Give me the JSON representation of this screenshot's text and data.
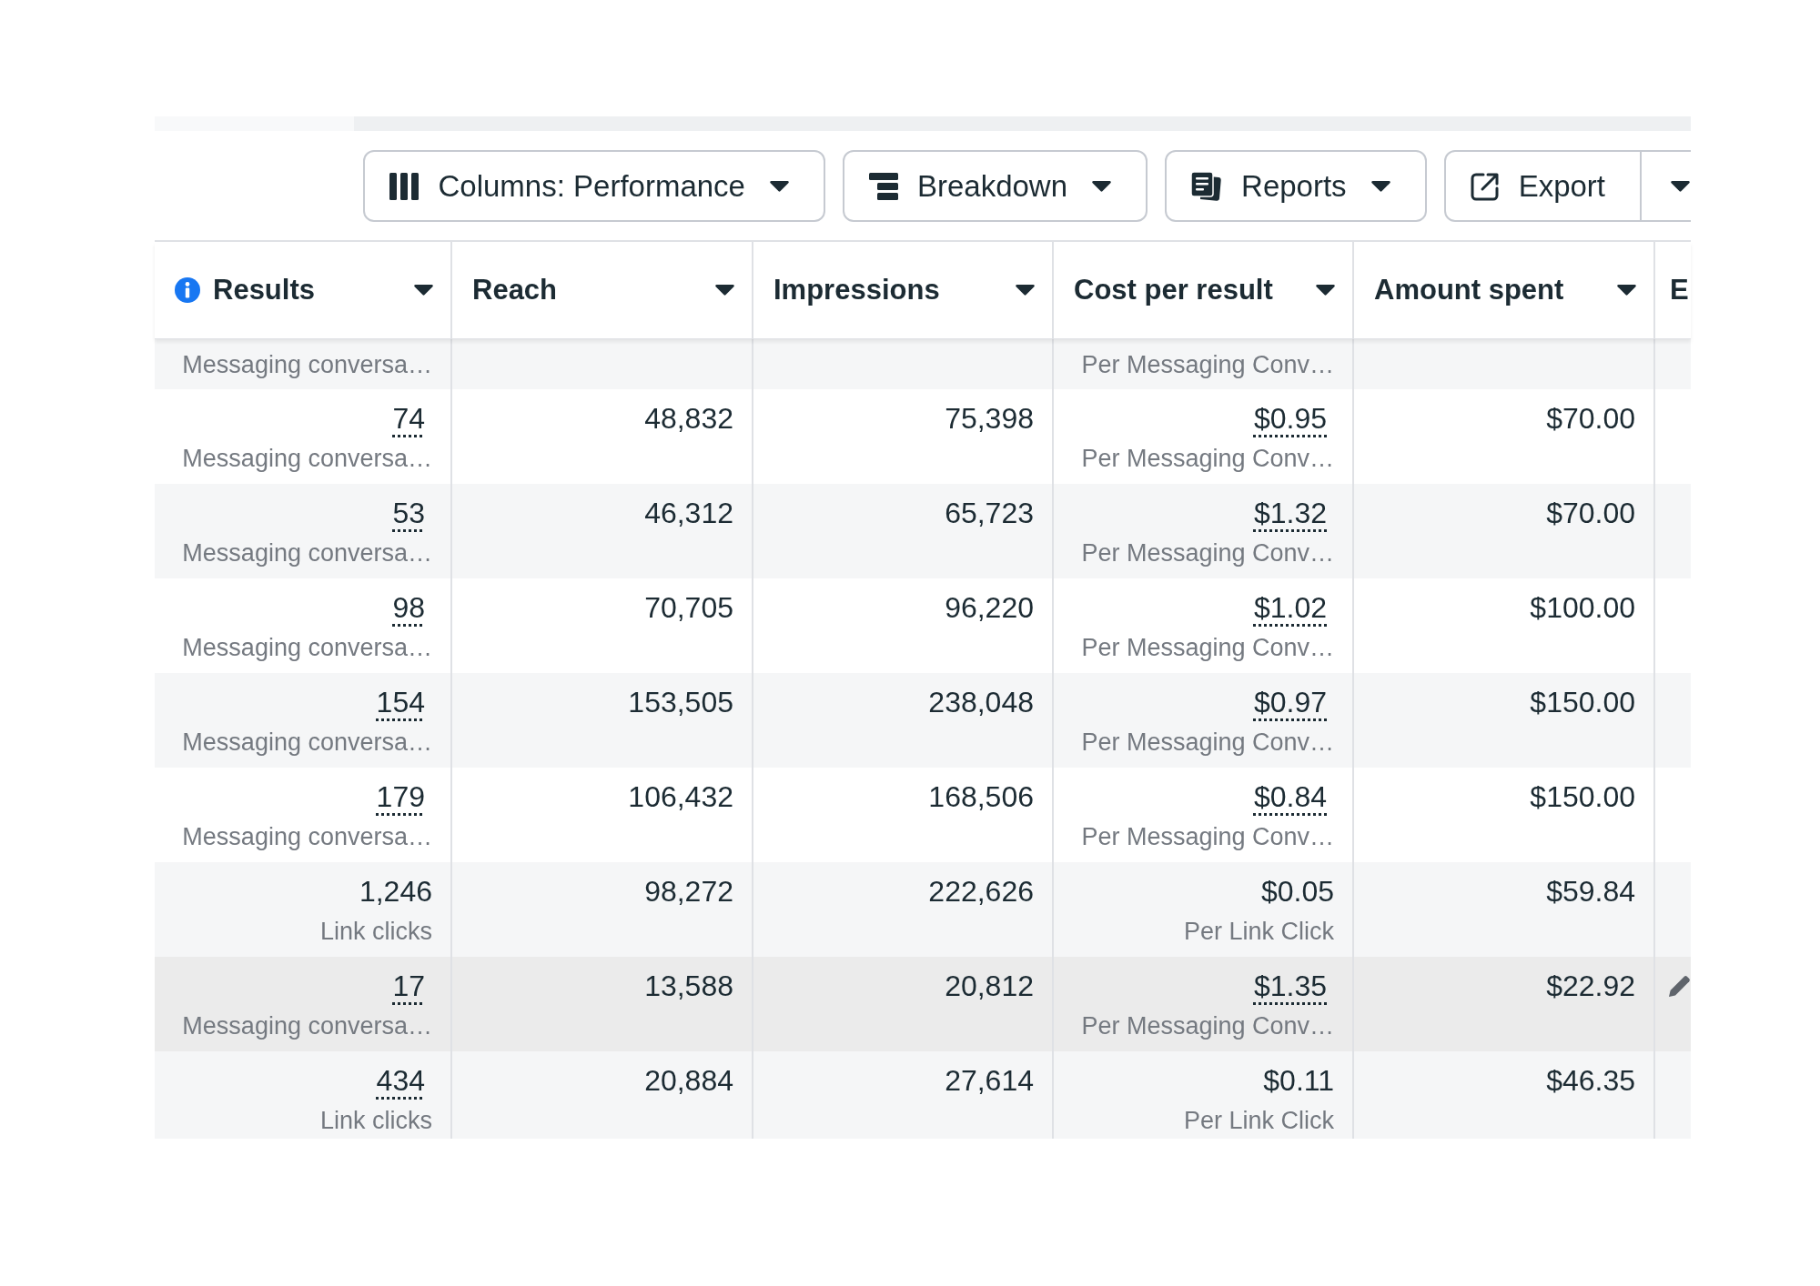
{
  "toolbar": {
    "buttons": [
      {
        "kind": "columns",
        "label": "Columns: Performance",
        "split": false
      },
      {
        "kind": "breakdown",
        "label": "Breakdown",
        "split": false
      },
      {
        "kind": "reports",
        "label": "Reports",
        "split": false
      },
      {
        "kind": "export",
        "label": "Export",
        "split": true
      }
    ]
  },
  "table": {
    "columns": [
      {
        "label": "Results",
        "info": true,
        "dropdown": true
      },
      {
        "label": "Reach",
        "info": false,
        "dropdown": true
      },
      {
        "label": "Impressions",
        "info": false,
        "dropdown": true
      },
      {
        "label": "Cost per result",
        "info": false,
        "dropdown": true
      },
      {
        "label": "Amount spent",
        "info": false,
        "dropdown": true
      },
      {
        "label": "E",
        "info": false
      }
    ],
    "rows": [
      {
        "hovered": false,
        "results": {
          "label": "Messaging conversa…"
        },
        "cost_per_result": {
          "label": "Per Messaging Conv…"
        }
      },
      {
        "hovered": false,
        "results": {
          "value": "74",
          "linked": true,
          "label": "Messaging conversa…"
        },
        "reach": "48,832",
        "impressions": "75,398",
        "cost_per_result": {
          "value": "$0.95",
          "linked": true,
          "label": "Per Messaging Conv…"
        },
        "amount_spent": "$70.00"
      },
      {
        "hovered": false,
        "results": {
          "value": "53",
          "linked": true,
          "label": "Messaging conversa…"
        },
        "reach": "46,312",
        "impressions": "65,723",
        "cost_per_result": {
          "value": "$1.32",
          "linked": true,
          "label": "Per Messaging Conv…"
        },
        "amount_spent": "$70.00"
      },
      {
        "hovered": false,
        "results": {
          "value": "98",
          "linked": true,
          "label": "Messaging conversa…"
        },
        "reach": "70,705",
        "impressions": "96,220",
        "cost_per_result": {
          "value": "$1.02",
          "linked": true,
          "label": "Per Messaging Conv…"
        },
        "amount_spent": "$100.00"
      },
      {
        "hovered": false,
        "results": {
          "value": "154",
          "linked": true,
          "label": "Messaging conversa…"
        },
        "reach": "153,505",
        "impressions": "238,048",
        "cost_per_result": {
          "value": "$0.97",
          "linked": true,
          "label": "Per Messaging Conv…"
        },
        "amount_spent": "$150.00"
      },
      {
        "hovered": false,
        "results": {
          "value": "179",
          "linked": true,
          "label": "Messaging conversa…"
        },
        "reach": "106,432",
        "impressions": "168,506",
        "cost_per_result": {
          "value": "$0.84",
          "linked": true,
          "label": "Per Messaging Conv…"
        },
        "amount_spent": "$150.00"
      },
      {
        "hovered": false,
        "results": {
          "value": "1,246",
          "linked": false,
          "label": "Link clicks"
        },
        "reach": "98,272",
        "impressions": "222,626",
        "cost_per_result": {
          "value": "$0.05",
          "linked": false,
          "label": "Per Link Click"
        },
        "amount_spent": "$59.84"
      },
      {
        "hovered": true,
        "results": {
          "value": "17",
          "linked": true,
          "label": "Messaging conversa…"
        },
        "reach": "13,588",
        "impressions": "20,812",
        "cost_per_result": {
          "value": "$1.35",
          "linked": true,
          "label": "Per Messaging Conv…"
        },
        "amount_spent": "$22.92"
      },
      {
        "hovered": false,
        "results": {
          "value": "434",
          "linked": true,
          "label": "Link clicks"
        },
        "reach": "20,884",
        "impressions": "27,614",
        "cost_per_result": {
          "value": "$0.11",
          "linked": false,
          "label": "Per Link Click"
        },
        "amount_spent": "$46.35"
      }
    ]
  }
}
